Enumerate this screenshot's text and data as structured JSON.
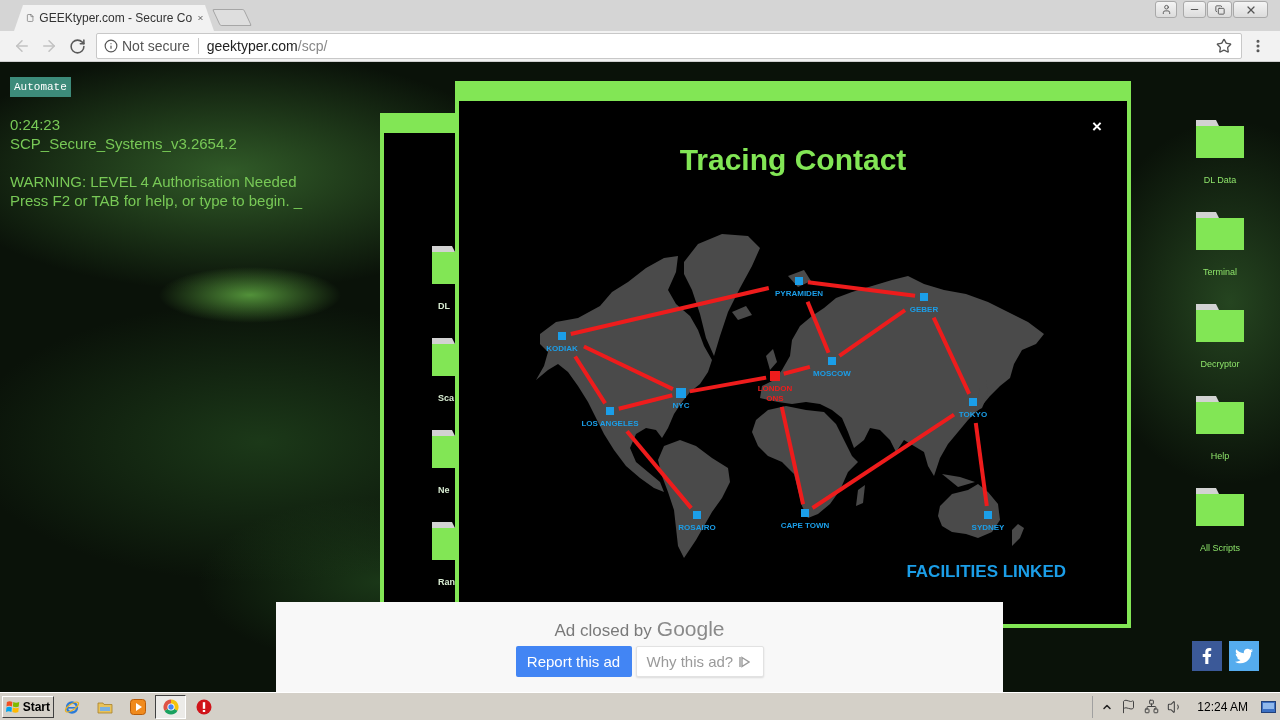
{
  "browser": {
    "tab": {
      "title": "GEEKtyper.com - Secure Co"
    },
    "toolbar": {
      "back_disabled": true,
      "forward_disabled": true
    },
    "address_bar": {
      "security": "Not secure",
      "host": "geektyper.com",
      "path": "/scp/"
    }
  },
  "page": {
    "automate_button": "Automate",
    "console_blocks": [
      [
        "0:24:23",
        "SCP_Secure_Systems_v3.2654.2"
      ],
      [
        "WARNING: LEVEL 4 Authorisation Needed",
        "Press F2 or TAB for help, or type to begin. _"
      ]
    ],
    "back_window": {
      "folders": [
        "DL",
        "Sca",
        "Ne",
        "Ran"
      ]
    },
    "tracing_window": {
      "close": "×",
      "title": "Tracing Contact",
      "cities": [
        {
          "name": "KODIAK",
          "color": "#1b9ee8"
        },
        {
          "name": "PYRAMIDEN",
          "color": "#1b9ee8"
        },
        {
          "name": "GEBER",
          "color": "#1b9ee8"
        },
        {
          "name": "MOSCOW",
          "color": "#1b9ee8"
        },
        {
          "name": "LONDON",
          "subtitle": "ONS",
          "color": "#ee1c1c"
        },
        {
          "name": "NYC",
          "color": "#1b9ee8"
        },
        {
          "name": "LOS ANGELES",
          "color": "#1b9ee8"
        },
        {
          "name": "TOKYO",
          "color": "#1b9ee8"
        },
        {
          "name": "ROSAIRO",
          "color": "#1b9ee8"
        },
        {
          "name": "CAPE TOWN",
          "color": "#1b9ee8"
        },
        {
          "name": "SYDNEY",
          "color": "#1b9ee8"
        }
      ],
      "status": "FACILITIES LINKED"
    },
    "desktop_folders": [
      "DL Data",
      "Terminal",
      "Decryptor",
      "Help",
      "All Scripts"
    ],
    "ad": {
      "message": "Ad closed by",
      "brand": "Google",
      "buttons": [
        {
          "label": "Report this ad",
          "kind": "primary"
        },
        {
          "label": "Why this ad?",
          "kind": "info"
        }
      ]
    }
  },
  "taskbar": {
    "start": "Start",
    "apps": [
      {
        "kind": "ie",
        "selected": false
      },
      {
        "kind": "explorer",
        "selected": false
      },
      {
        "kind": "media",
        "selected": false
      },
      {
        "kind": "chrome",
        "selected": true
      },
      {
        "kind": "alert",
        "selected": false
      }
    ],
    "clock": "12:24 AM"
  }
}
